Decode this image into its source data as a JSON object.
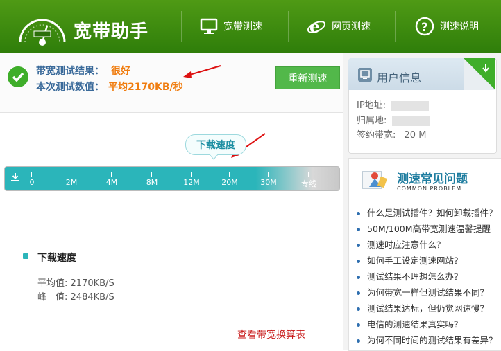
{
  "app": {
    "title": "宽带助手"
  },
  "nav": [
    {
      "label": "宽带测速",
      "icon": "monitor-icon"
    },
    {
      "label": "网页测速",
      "icon": "ie-browser-icon"
    },
    {
      "label": "测速说明",
      "icon": "help-icon"
    }
  ],
  "result": {
    "label_result": "带宽测试结果：",
    "value_result": "很好",
    "label_value": "本次测试数值：",
    "value_speed": "平均2170KB/秒",
    "retest_label": "重新测速"
  },
  "speed_meter": {
    "bubble": "下载速度",
    "ticks": [
      "0",
      "2M",
      "4M",
      "8M",
      "12M",
      "20M",
      "30M",
      "专线"
    ]
  },
  "download": {
    "title": "下载速度",
    "avg_label": "平均值:",
    "avg_value": "2170KB/S",
    "peak_label": "峰　值:",
    "peak_value": "2484KB/S"
  },
  "table_link": "查看带宽换算表",
  "user_info": {
    "title": "用户信息",
    "ip_label": "IP地址:",
    "region_label": "归属地:",
    "bandwidth_label": "签约带宽:",
    "bandwidth_value": "20 M"
  },
  "faq": {
    "title": "测速常见问题",
    "subtitle": "COMMON PROBLEM",
    "items": [
      "什么是测试插件？如何卸载插件？",
      "50M/100M高带宽测速温馨提醒",
      "测速时应注意什么？",
      "如何手工设定测速网站？",
      "测试结果不理想怎么办？",
      "为何带宽一样但测试结果不同？",
      "测试结果达标，但仍觉网速慢？",
      "电信的测速结果真实吗？",
      "为何不同时间的测试结果有差异？"
    ]
  },
  "colors": {
    "header_green": "#3d8a10",
    "accent_orange": "#f07d10",
    "bar_teal": "#2bb5ba",
    "link_red": "#c81818"
  }
}
